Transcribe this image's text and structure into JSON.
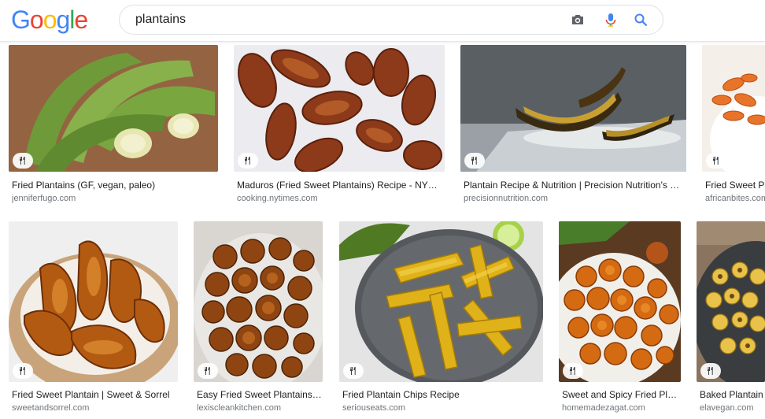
{
  "search": {
    "query": "plantains"
  },
  "results": [
    {
      "caption": "Fried Plantains (GF, vegan, paleo)",
      "domain": "jenniferfugo.com"
    },
    {
      "caption": "Maduros (Fried Sweet Plantains) Recipe - NY…",
      "domain": "cooking.nytimes.com"
    },
    {
      "caption": "Plantain Recipe & Nutrition | Precision Nutrition's …",
      "domain": "precisionnutrition.com"
    },
    {
      "caption": "Fried Sweet P",
      "domain": "africanbites.com"
    },
    {
      "caption": "Fried Sweet Plantain | Sweet & Sorrel",
      "domain": "sweetandsorrel.com"
    },
    {
      "caption": "Easy Fried Sweet Plantains…",
      "domain": "lexiscleankitchen.com"
    },
    {
      "caption": "Fried Plantain Chips Recipe",
      "domain": "seriouseats.com"
    },
    {
      "caption": "Sweet and Spicy Fried Pl…",
      "domain": "homemadezagat.com"
    },
    {
      "caption": "Baked Plantain",
      "domain": "elavegan.com"
    }
  ],
  "colors": {
    "google_blue": "#4285f4",
    "google_red": "#ea4335",
    "google_yellow": "#fbbc05",
    "google_green": "#34a853"
  }
}
